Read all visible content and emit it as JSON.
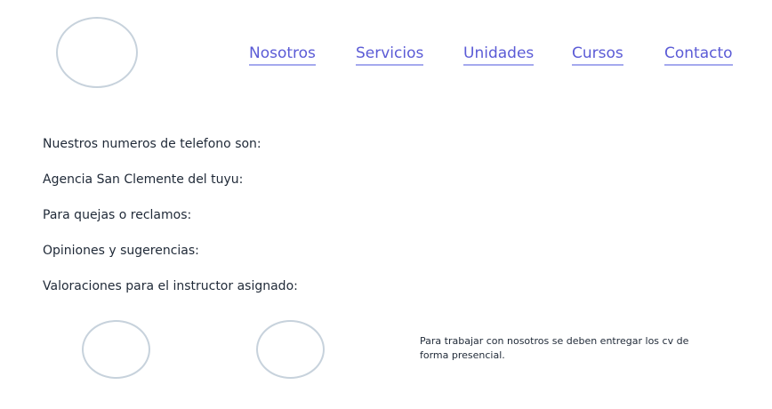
{
  "nav": {
    "items": [
      {
        "label": "Nosotros"
      },
      {
        "label": "Servicios"
      },
      {
        "label": "Unidades"
      },
      {
        "label": "Cursos"
      },
      {
        "label": "Contacto"
      }
    ]
  },
  "content": {
    "lines": [
      "Nuestros numeros de telefono son:",
      "Agencia San Clemente del tuyu:",
      "Para quejas o reclamos:",
      "Opiniones y sugerencias:",
      "Valoraciones para el instructor asignado:"
    ]
  },
  "note": "Para trabajar con nosotros se deben entregar los cv de forma presencial."
}
